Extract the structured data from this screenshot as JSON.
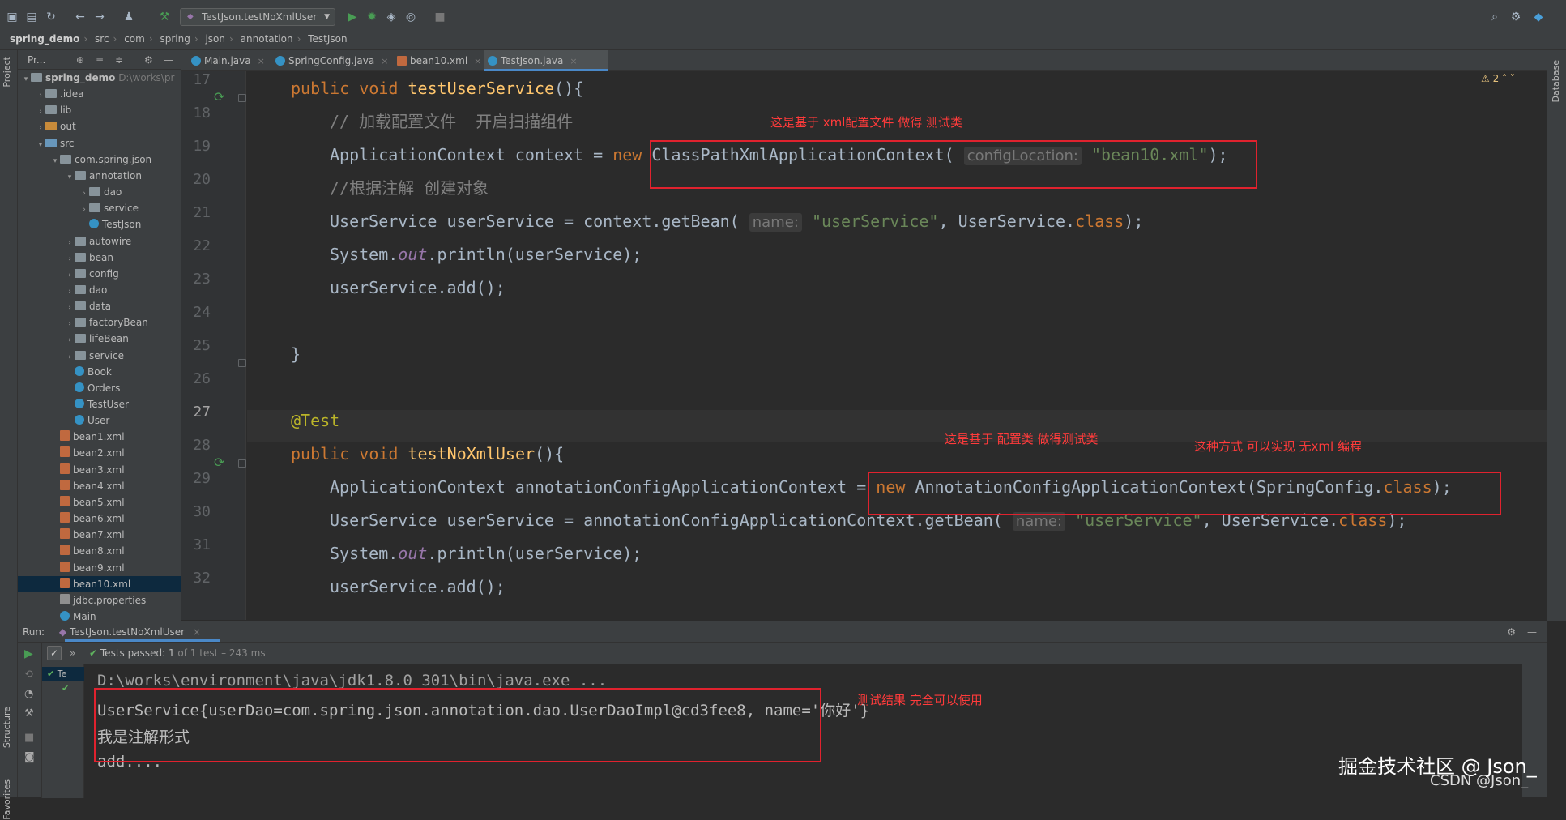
{
  "toolbar": {
    "run_config": "TestJson.testNoXmlUser"
  },
  "breadcrumb": [
    "spring_demo",
    "src",
    "com",
    "spring",
    "json",
    "annotation",
    "TestJson"
  ],
  "left_strip": {
    "project": "Project",
    "structure": "Structure",
    "favorites": "Favorites"
  },
  "right_strip": {
    "database": "Database"
  },
  "project_panel": {
    "header": "Pr...",
    "items": [
      {
        "label": "spring_demo",
        "extra": "D:\\works\\pr",
        "depth": 0,
        "icon": "folder",
        "arrow": "v"
      },
      {
        "label": ".idea",
        "depth": 1,
        "icon": "folder",
        "arrow": ">"
      },
      {
        "label": "lib",
        "depth": 1,
        "icon": "folder",
        "arrow": ">"
      },
      {
        "label": "out",
        "depth": 1,
        "icon": "folder-orange",
        "arrow": ">"
      },
      {
        "label": "src",
        "depth": 1,
        "icon": "folder-blue",
        "arrow": "v"
      },
      {
        "label": "com.spring.json",
        "depth": 2,
        "icon": "folder",
        "arrow": "v"
      },
      {
        "label": "annotation",
        "depth": 3,
        "icon": "folder",
        "arrow": "v"
      },
      {
        "label": "dao",
        "depth": 4,
        "icon": "folder",
        "arrow": ">"
      },
      {
        "label": "service",
        "depth": 4,
        "icon": "folder",
        "arrow": ">"
      },
      {
        "label": "TestJson",
        "depth": 4,
        "icon": "class",
        "arrow": ""
      },
      {
        "label": "autowire",
        "depth": 3,
        "icon": "folder",
        "arrow": ">"
      },
      {
        "label": "bean",
        "depth": 3,
        "icon": "folder",
        "arrow": ">"
      },
      {
        "label": "config",
        "depth": 3,
        "icon": "folder",
        "arrow": ">"
      },
      {
        "label": "dao",
        "depth": 3,
        "icon": "folder",
        "arrow": ">"
      },
      {
        "label": "data",
        "depth": 3,
        "icon": "folder",
        "arrow": ">"
      },
      {
        "label": "factoryBean",
        "depth": 3,
        "icon": "folder",
        "arrow": ">"
      },
      {
        "label": "lifeBean",
        "depth": 3,
        "icon": "folder",
        "arrow": ">"
      },
      {
        "label": "service",
        "depth": 3,
        "icon": "folder",
        "arrow": ">"
      },
      {
        "label": "Book",
        "depth": 3,
        "icon": "class",
        "arrow": ""
      },
      {
        "label": "Orders",
        "depth": 3,
        "icon": "class",
        "arrow": ""
      },
      {
        "label": "TestUser",
        "depth": 3,
        "icon": "class",
        "arrow": ""
      },
      {
        "label": "User",
        "depth": 3,
        "icon": "class",
        "arrow": ""
      },
      {
        "label": "bean1.xml",
        "depth": 2,
        "icon": "xml",
        "arrow": ""
      },
      {
        "label": "bean2.xml",
        "depth": 2,
        "icon": "xml",
        "arrow": ""
      },
      {
        "label": "bean3.xml",
        "depth": 2,
        "icon": "xml",
        "arrow": ""
      },
      {
        "label": "bean4.xml",
        "depth": 2,
        "icon": "xml",
        "arrow": ""
      },
      {
        "label": "bean5.xml",
        "depth": 2,
        "icon": "xml",
        "arrow": ""
      },
      {
        "label": "bean6.xml",
        "depth": 2,
        "icon": "xml",
        "arrow": ""
      },
      {
        "label": "bean7.xml",
        "depth": 2,
        "icon": "xml",
        "arrow": ""
      },
      {
        "label": "bean8.xml",
        "depth": 2,
        "icon": "xml",
        "arrow": ""
      },
      {
        "label": "bean9.xml",
        "depth": 2,
        "icon": "xml",
        "arrow": ""
      },
      {
        "label": "bean10.xml",
        "depth": 2,
        "icon": "xml",
        "arrow": "",
        "selected": true
      },
      {
        "label": "jdbc.properties",
        "depth": 2,
        "icon": "props",
        "arrow": ""
      },
      {
        "label": "Main",
        "depth": 2,
        "icon": "class",
        "arrow": ""
      }
    ]
  },
  "editor_tabs": [
    {
      "label": "Main.java",
      "icon": "class"
    },
    {
      "label": "SpringConfig.java",
      "icon": "class"
    },
    {
      "label": "bean10.xml",
      "icon": "xml"
    },
    {
      "label": "TestJson.java",
      "icon": "class",
      "active": true
    }
  ],
  "warnings": "2",
  "editor": {
    "line_numbers": [
      "17",
      "18",
      "19",
      "20",
      "21",
      "22",
      "23",
      "24",
      "25",
      "26",
      "27",
      "28",
      "29",
      "30",
      "31",
      "32"
    ],
    "current_line": "27"
  },
  "notes": {
    "xml_note": "这是基于 xml配置文件 做得 测试类",
    "config_note": "这是基于 配置类 做得测试类",
    "noxml_note": "这种方式 可以实现 无xml 编程",
    "result_note": "测试结果 完全可以使用"
  },
  "run_panel": {
    "label": "Run:",
    "tab": "TestJson.testNoXmlUser",
    "tests_passed": "Tests passed:",
    "count": "1",
    "of_total": "of 1 test – 243 ms",
    "tree_item": "Te",
    "console_lines": [
      "D:\\works\\environment\\java\\jdk1.8.0_301\\bin\\java.exe ...",
      "UserService{userDao=com.spring.json.annotation.dao.UserDaoImpl@cd3fee8, name='你好'}",
      "我是注解形式",
      "add...."
    ]
  },
  "watermark": {
    "line1": "掘金技术社区 @ Json_",
    "line2": "CSDN @Json_"
  },
  "colors": {
    "keyword": "#cc7832",
    "method": "#ffc66d",
    "string": "#6a8759",
    "comment": "#808080",
    "annotation_box": "#e0222e",
    "note_text": "#ff3b3b"
  }
}
